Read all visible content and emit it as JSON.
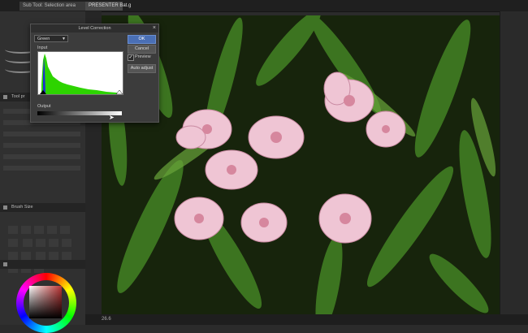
{
  "tabs": [
    {
      "label": "Sub Tool: Selection area"
    },
    {
      "label": "PRESENTER Bat.g"
    }
  ],
  "dialog": {
    "title": "Level Correction",
    "channel_value": "Green",
    "input_label": "Input",
    "output_label": "Output",
    "ok_label": "OK",
    "cancel_label": "Cancel",
    "preview_label": "Preview",
    "auto_adjust_label": "Auto adjust"
  },
  "panels": {
    "brush_size_title": "Brush Size",
    "tool_property_title": "Tool pr"
  },
  "status": {
    "zoom": "26.6"
  },
  "colors": {
    "accent": "#4a6fb5",
    "histogram": "#2dd400",
    "histogram_blue": "#1d2bd6"
  }
}
